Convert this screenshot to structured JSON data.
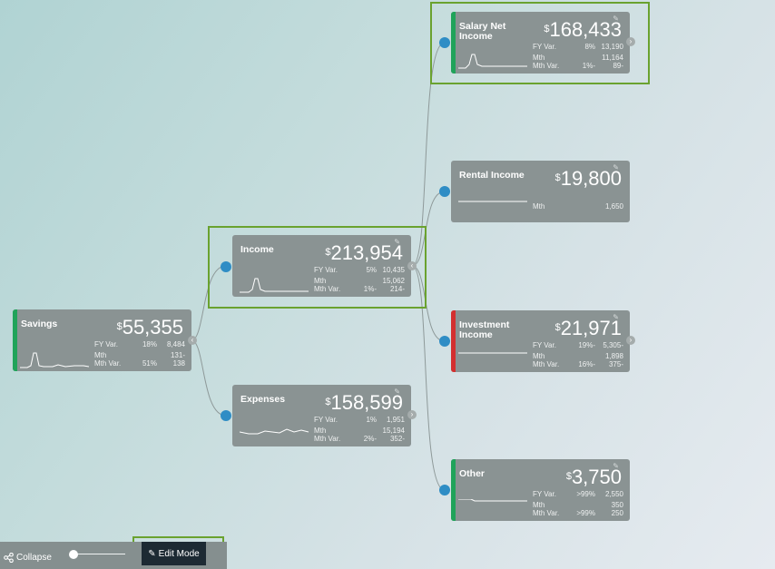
{
  "colors": {
    "green": "#20a35a",
    "red": "#d32f2f",
    "dot": "#2f8dc5",
    "card": "#8a9393"
  },
  "icons": {
    "edit": "pencil-icon",
    "collapse": "share-icon",
    "toggle": "chevron-icon"
  },
  "cards": {
    "savings": {
      "title": "Savings",
      "currency": "$",
      "amount": "55,355",
      "rows": [
        {
          "label": "FY Var.",
          "pct": "18%",
          "value": "8,484"
        },
        {
          "label": "Mth",
          "pct": "",
          "value": "131-"
        },
        {
          "label": "Mth Var.",
          "pct": "51%",
          "value": "138"
        }
      ]
    },
    "income": {
      "title": "Income",
      "currency": "$",
      "amount": "213,954",
      "rows": [
        {
          "label": "FY Var.",
          "pct": "5%",
          "value": "10,435"
        },
        {
          "label": "Mth",
          "pct": "",
          "value": "15,062"
        },
        {
          "label": "Mth Var.",
          "pct": "1%-",
          "value": "214-"
        }
      ]
    },
    "expenses": {
      "title": "Expenses",
      "currency": "$",
      "amount": "158,599",
      "rows": [
        {
          "label": "FY Var.",
          "pct": "1%",
          "value": "1,951"
        },
        {
          "label": "Mth",
          "pct": "",
          "value": "15,194"
        },
        {
          "label": "Mth Var.",
          "pct": "2%-",
          "value": "352-"
        }
      ]
    },
    "salary": {
      "title": "Salary Net Income",
      "currency": "$",
      "amount": "168,433",
      "rows": [
        {
          "label": "FY Var.",
          "pct": "8%",
          "value": "13,190"
        },
        {
          "label": "Mth",
          "pct": "",
          "value": "11,164"
        },
        {
          "label": "Mth Var.",
          "pct": "1%-",
          "value": "89-"
        }
      ]
    },
    "rental": {
      "title": "Rental Income",
      "currency": "$",
      "amount": "19,800",
      "rows": [
        {
          "label": "Mth",
          "pct": "",
          "value": "1,650"
        }
      ]
    },
    "investment": {
      "title": "Investment Income",
      "currency": "$",
      "amount": "21,971",
      "rows": [
        {
          "label": "FY Var.",
          "pct": "19%-",
          "value": "5,305-"
        },
        {
          "label": "Mth",
          "pct": "",
          "value": "1,898"
        },
        {
          "label": "Mth Var.",
          "pct": "16%-",
          "value": "375-"
        }
      ]
    },
    "other": {
      "title": "Other",
      "currency": "$",
      "amount": "3,750",
      "rows": [
        {
          "label": "FY Var.",
          "pct": ">99%",
          "value": "2,550"
        },
        {
          "label": "Mth",
          "pct": "",
          "value": "350"
        },
        {
          "label": "Mth Var.",
          "pct": ">99%",
          "value": "250"
        }
      ]
    }
  },
  "toolbar": {
    "collapse_label": "Collapse",
    "edit_mode_label": "Edit Mode"
  }
}
